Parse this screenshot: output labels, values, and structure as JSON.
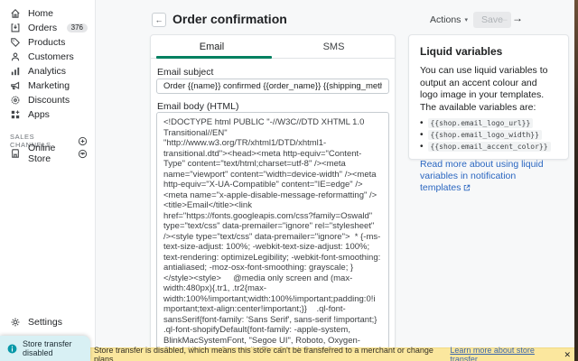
{
  "sidebar": {
    "items": [
      {
        "label": "Home"
      },
      {
        "label": "Orders",
        "badge": "376"
      },
      {
        "label": "Products"
      },
      {
        "label": "Customers"
      },
      {
        "label": "Analytics"
      },
      {
        "label": "Marketing"
      },
      {
        "label": "Discounts"
      },
      {
        "label": "Apps"
      }
    ],
    "sales_channels_label": "SALES CHANNELS",
    "online_store_label": "Online Store",
    "settings_label": "Settings",
    "store_transfer_label": "Store transfer disabled"
  },
  "header": {
    "title": "Order confirmation",
    "actions_label": "Actions",
    "save_label": "Save"
  },
  "editor": {
    "tabs": [
      {
        "label": "Email"
      },
      {
        "label": "SMS"
      }
    ],
    "subject_label": "Email subject",
    "subject_value": "Order {{name}} confirmed {{order_name}} {{shipping_method.title }}",
    "body_label": "Email body (HTML)",
    "body_value": "<!DOCTYPE html PUBLIC \"-//W3C//DTD XHTML 1.0 Transitional//EN\" \"http://www.w3.org/TR/xhtml1/DTD/xhtml1-transitional.dtd\"><head><meta http-equiv=\"Content-Type\" content=\"text/html;charset=utf-8\" /><meta name=\"viewport\" content=\"width=device-width\" /><meta http-equiv=\"X-UA-Compatible\" content=\"IE=edge\" /><meta name=\"x-apple-disable-message-reformatting\" /><title>Email</title><link href=\"https://fonts.googleapis.com/css?family=Oswald\" type=\"text/css\" data-premailer=\"ignore\" rel=\"stylesheet\" /><style type=\"text/css\" data-premailer=\"ignore\">  * {-ms-text-size-adjust: 100%; -webkit-text-size-adjust: 100%; text-rendering: optimizeLegibility; -webkit-font-smoothing: antialiased; -moz-osx-font-smoothing: grayscale; }    </style><style>     @media only screen and (max-width:480px){.tr1, .tr2{max-width:100%!important;width:100%!important;padding:0!important;text-align:center!important;}}    .ql-font-sansSerif{font-family: 'Sans Serif', sans-serif !important;}    .ql-font-shopifyDefault{font-family: -apple-system, BlinkMacSystemFont, \"Segoe UI\", Roboto, Oxygen-Sans, Ubuntu, Cantarell, 'Fira Sans', Droid Sans, \"Helvetica Neue\", sans-serif !important;}    .ql-font-arial{font-family: 'Arial', \"Helvetica Neue\", Helvetica, sans-serif !important;}    .ql-font-georgia{font-family: 'georgia', serif !important;}    .ql-font-comicSans{font-family: \"Comic Sans MS\", \"Comic Sans\", cursive !important;}    .ql-font-courierNew{font-family: \"Courier New\", Courier, \"Lucida Sans Typewriter\", \"Lucida Typewriter\", monospace !important;}    .ql-font-lucida{font-family: \"Lucida Grande\", \"Lucida Sans Unicode\", \"Lucida Sans\", Geneva, Verdana !important;}    .ql-font-tahoma{font-family: Tahoma, Verdana,"
  },
  "liquid_panel": {
    "title": "Liquid variables",
    "description": "You can use liquid variables to output an accent colour and logo image in your templates. The available variables are:",
    "variables": [
      "{{shop.email_logo_url}}",
      "{{shop.email_logo_width}}",
      "{{shop.email_accent_color}}"
    ],
    "link_text": "Read more about using liquid variables in notification templates"
  },
  "banner": {
    "text": "Store transfer is disabled, which means this store can't be transferred to a merchant or change plans.",
    "link_text": "Learn more about store transfer"
  },
  "icons": {
    "back_arrow": "←",
    "prev_arrow": "←",
    "next_arrow": "→",
    "caret_down": "▾",
    "close": "✕",
    "bullet": "•"
  },
  "colors": {
    "accent_green": "#008060",
    "link_blue": "#2a66c0",
    "banner_yellow": "#fbe79e",
    "info_teal": "#0898a8"
  }
}
